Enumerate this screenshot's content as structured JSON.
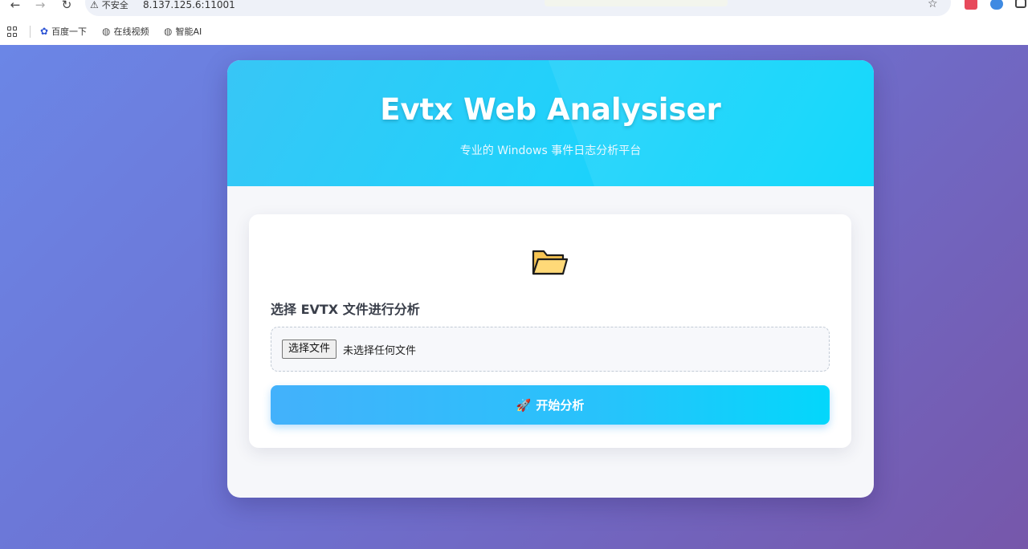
{
  "browser": {
    "security_label": "不安全",
    "url": "8.137.125.6:11001",
    "bookmarks": [
      {
        "label": "百度一下",
        "icon": "baidu-paw-icon"
      },
      {
        "label": "在线视频",
        "icon": "globe-icon"
      },
      {
        "label": "智能AI",
        "icon": "globe-icon"
      }
    ]
  },
  "app": {
    "title": "Evtx Web Analysiser",
    "subtitle": "专业的 Windows 事件日志分析平台",
    "upload": {
      "icon": "folder-icon",
      "label": "选择 EVTX 文件进行分析",
      "file_button_label": "选择文件",
      "file_status": "未选择任何文件"
    },
    "analyze_button": {
      "icon": "rocket-icon",
      "label": "开始分析"
    }
  },
  "colors": {
    "header_gradient_start": "#38c6f6",
    "header_gradient_end": "#02d6fb",
    "page_gradient_start": "#6b86e6",
    "page_gradient_end": "#7657aa",
    "button_gradient_start": "#43b1fb",
    "button_gradient_end": "#03d7fb"
  }
}
